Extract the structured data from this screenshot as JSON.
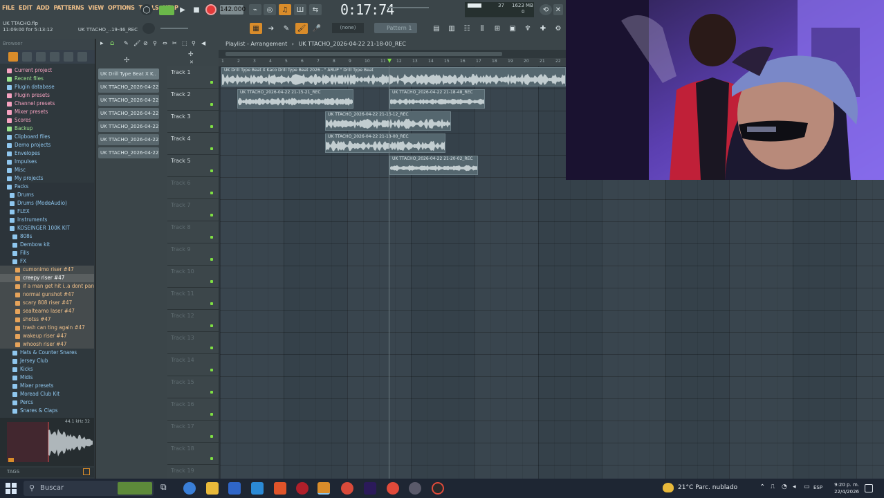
{
  "menu": {
    "file": "FILE",
    "edit": "EDIT",
    "add": "ADD",
    "patterns": "PATTERNS",
    "view": "VIEW",
    "options": "OPTIONS",
    "tools": "TOOLS",
    "help": "HELP"
  },
  "project": {
    "filename": "UK TTACHO.flp",
    "time_info": "11:09:00 for 5:13:12",
    "hint": "UK TTACHO_..19-46_REC"
  },
  "transport": {
    "tempo": "142.000",
    "time": "0:17:74",
    "pattern": "Pattern 1",
    "snap": "(none)"
  },
  "monitor": {
    "cpu": "37",
    "memory": "1623 MB",
    "voices": "0"
  },
  "browser": {
    "header": "Browser",
    "items": [
      {
        "label": "Current project",
        "kind": "folder-pink"
      },
      {
        "label": "Recent files",
        "kind": "folder-green"
      },
      {
        "label": "Plugin database",
        "kind": "folder-blue"
      },
      {
        "label": "Plugin presets",
        "kind": "folder-pink"
      },
      {
        "label": "Channel presets",
        "kind": "folder-pink"
      },
      {
        "label": "Mixer presets",
        "kind": "folder-pink"
      },
      {
        "label": "Scores",
        "kind": "folder-pink"
      },
      {
        "label": "Backup",
        "kind": "folder-green"
      },
      {
        "label": "Clipboard files",
        "kind": "folder-blue"
      },
      {
        "label": "Demo projects",
        "kind": "folder-blue"
      },
      {
        "label": "Envelopes",
        "kind": "folder-blue"
      },
      {
        "label": "Impulses",
        "kind": "folder-blue"
      },
      {
        "label": "Misc",
        "kind": "folder-blue"
      },
      {
        "label": "My projects",
        "kind": "folder-blue"
      },
      {
        "label": "Packs",
        "kind": "folder-blue"
      },
      {
        "label": "Drums",
        "kind": "folder-blue"
      },
      {
        "label": "Drums (ModeAudio)",
        "kind": "folder-blue"
      },
      {
        "label": "FLEX",
        "kind": "folder-blue"
      },
      {
        "label": "Instruments",
        "kind": "folder-blue"
      },
      {
        "label": "KOSEINGER 100K KIT",
        "kind": "folder-blue"
      },
      {
        "label": "808s",
        "kind": "folder-blue"
      },
      {
        "label": "Dembow kit",
        "kind": "folder-blue"
      },
      {
        "label": "Fills",
        "kind": "folder-blue"
      },
      {
        "label": "FX",
        "kind": "folder-blue"
      },
      {
        "label": "cumonimo riser #47",
        "kind": "file-orange"
      },
      {
        "label": "creepy riser #47",
        "kind": "selected"
      },
      {
        "label": "if a man get hit i..a dont panic #47",
        "kind": "file-orange"
      },
      {
        "label": "normal gunshot #47",
        "kind": "file-orange"
      },
      {
        "label": "scary 808 riser #47",
        "kind": "file-orange"
      },
      {
        "label": "sealteamo laser #47",
        "kind": "file-orange"
      },
      {
        "label": "shotss #47",
        "kind": "file-orange"
      },
      {
        "label": "trash can ting again #47",
        "kind": "file-orange"
      },
      {
        "label": "wakeup riser #47",
        "kind": "file-orange"
      },
      {
        "label": "whoosh riser #47",
        "kind": "file-orange"
      },
      {
        "label": "Hats & Counter Snares",
        "kind": "folder-blue"
      },
      {
        "label": "Jersey Club",
        "kind": "folder-blue"
      },
      {
        "label": "Kicks",
        "kind": "folder-blue"
      },
      {
        "label": "Midis",
        "kind": "folder-blue"
      },
      {
        "label": "Mixer presets",
        "kind": "folder-blue"
      },
      {
        "label": "Moread Club Kit",
        "kind": "folder-blue"
      },
      {
        "label": "Percs",
        "kind": "folder-blue"
      },
      {
        "label": "Snares & Claps",
        "kind": "folder-blue"
      }
    ],
    "preview_info": "44.1 kHz 32",
    "search_label": "TAGS"
  },
  "patterns": [
    "UK Drill Type Beat X K..",
    "UK TTACHO_2026-04-22 2..",
    "UK TTACHO_2026-04-22 2..",
    "UK TTACHO_2026-04-22 2..",
    "UK TTACHO_2026-04-22 2..",
    "UK TTACHO_2026-04-22 2..",
    "UK TTACHO_2026-04-22 2.."
  ],
  "playlist": {
    "title": "Playlist - Arrangement",
    "current_pattern": "UK TTACHO_2026-04-22 21-18-00_REC",
    "ruler": [
      "1",
      "2",
      "3",
      "4",
      "5",
      "6",
      "7",
      "8",
      "9",
      "10",
      "11",
      "12",
      "13",
      "14",
      "15",
      "16",
      "17",
      "18",
      "19",
      "20",
      "21",
      "22"
    ],
    "tracks": [
      {
        "name": "Track 1",
        "active": true
      },
      {
        "name": "Track 2",
        "active": true
      },
      {
        "name": "Track 3",
        "active": true
      },
      {
        "name": "Track 4",
        "active": true
      },
      {
        "name": "Track 5",
        "active": true
      },
      {
        "name": "Track 6",
        "active": false
      },
      {
        "name": "Track 7",
        "active": false
      },
      {
        "name": "Track 8",
        "active": false
      },
      {
        "name": "Track 9",
        "active": false
      },
      {
        "name": "Track 10",
        "active": false
      },
      {
        "name": "Track 11",
        "active": false
      },
      {
        "name": "Track 12",
        "active": false
      },
      {
        "name": "Track 13",
        "active": false
      },
      {
        "name": "Track 14",
        "active": false
      },
      {
        "name": "Track 15",
        "active": false
      },
      {
        "name": "Track 16",
        "active": false
      },
      {
        "name": "Track 17",
        "active": false
      },
      {
        "name": "Track 18",
        "active": false
      },
      {
        "name": "Track 19",
        "active": false
      }
    ],
    "clips": [
      {
        "label": "UK Drill Type Beat X Kaco Drill Type Beat 2026 - \" ARUP \" Drill Type Beat",
        "track": 0
      },
      {
        "label": "UK TTACHO_2026-04-22 21-15-21_REC",
        "track": 1
      },
      {
        "label": "UK TTACHO_2026-04-22 21-18-48_REC",
        "track": 1
      },
      {
        "label": "UK TTACHO_2026-04-22 21-16-12_REC",
        "track": 2
      },
      {
        "label": "UK TTACHO_2026-04-22 21-18-00_REC",
        "track": 3
      },
      {
        "label": "UK TTACHO_2026-04-22 21-20-02_REC",
        "track": 4
      }
    ]
  },
  "taskbar": {
    "search_placeholder": "Buscar",
    "weather": "21°C Parc. nublado",
    "language": "ESP",
    "time": "9:20 p. m.",
    "date": "22/4/2026"
  },
  "colors": {
    "menu_text": "#f1c18a",
    "record": "#e33a3a",
    "accent_orange": "#d98c2a",
    "track_led": "#7fe043",
    "clip": "#55676f",
    "grid": "#35414a"
  }
}
